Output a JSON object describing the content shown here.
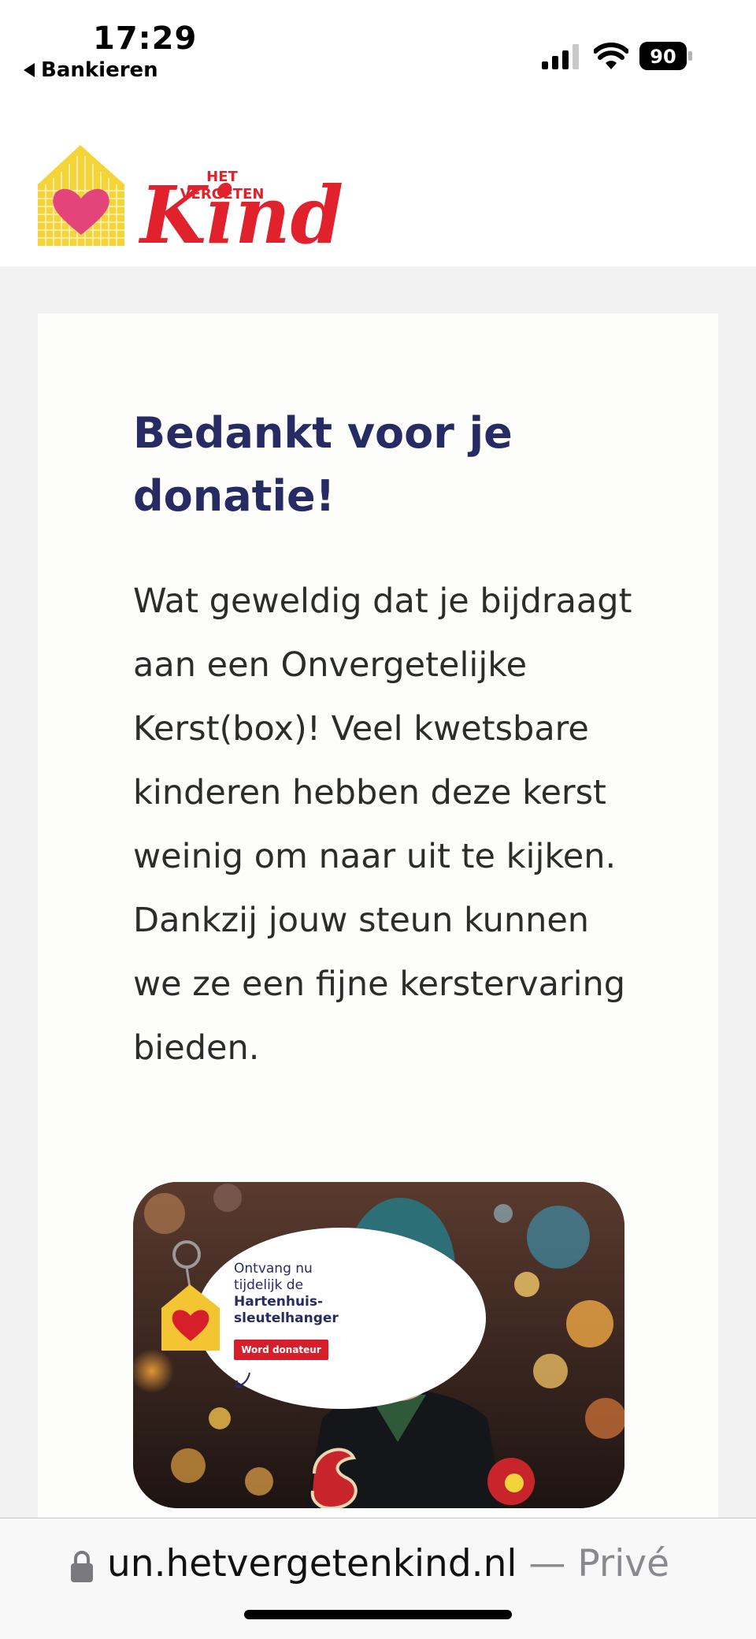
{
  "status_bar": {
    "time": "17:29",
    "back_label": "Bankieren",
    "battery_level": "90"
  },
  "logo": {
    "line1": "HET",
    "line2": "VERGETEN",
    "word": "Kind",
    "brand_red": "#e1222d",
    "brand_yellow": "#f4d437",
    "brand_pink": "#e3457a"
  },
  "card": {
    "title": "Bedankt voor je donatie!",
    "body": "Wat geweldig dat je bijdraagt aan een Onvergetelijke Kerst(box)! Veel kwetsbare kinderen hebben deze kerst weinig om naar uit te kijken. Dankzij jouw steun kunnen we ze een fijne kerstervaring bieden.",
    "title_color": "#272b63"
  },
  "banner": {
    "line1": "Ontvang nu",
    "line2": "tijdelijk de",
    "line3": "Hartenhuis-",
    "line4": "sleutelhanger",
    "button_label": "Word donateur"
  },
  "browser": {
    "url": "un.hetvergetenkind.nl",
    "separator": "—",
    "mode": "Privé"
  }
}
